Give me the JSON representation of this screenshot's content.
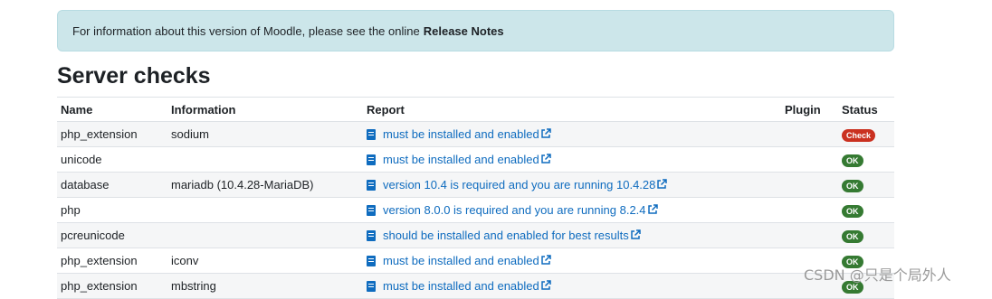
{
  "alert": {
    "text": "For information about this version of Moodle, please see the online",
    "link": "Release Notes"
  },
  "section_title": "Server checks",
  "table": {
    "headers": [
      "Name",
      "Information",
      "Report",
      "Plugin",
      "Status"
    ],
    "rows": [
      {
        "name": "php_extension",
        "info": "sodium",
        "report": "must be installed and enabled",
        "plugin": "",
        "status": "Check",
        "status_type": "error"
      },
      {
        "name": "unicode",
        "info": "",
        "report": "must be installed and enabled",
        "plugin": "",
        "status": "OK",
        "status_type": "ok"
      },
      {
        "name": "database",
        "info": "mariadb (10.4.28-MariaDB)",
        "report": "version 10.4 is required and you are running 10.4.28",
        "plugin": "",
        "status": "OK",
        "status_type": "ok"
      },
      {
        "name": "php",
        "info": "",
        "report": "version 8.0.0 is required and you are running 8.2.4",
        "plugin": "",
        "status": "OK",
        "status_type": "ok"
      },
      {
        "name": "pcreunicode",
        "info": "",
        "report": "should be installed and enabled for best results",
        "plugin": "",
        "status": "OK",
        "status_type": "ok"
      },
      {
        "name": "php_extension",
        "info": "iconv",
        "report": "must be installed and enabled",
        "plugin": "",
        "status": "OK",
        "status_type": "ok"
      },
      {
        "name": "php_extension",
        "info": "mbstring",
        "report": "must be installed and enabled",
        "plugin": "",
        "status": "OK",
        "status_type": "ok"
      }
    ]
  },
  "watermark": "CSDN @只是个局外人",
  "colors": {
    "link": "#0f6cbf",
    "ok": "#357a32",
    "check": "#ca3120",
    "alert_bg": "#cce6ea"
  },
  "icons": {
    "report": "book-icon",
    "external": "external-link-icon"
  }
}
